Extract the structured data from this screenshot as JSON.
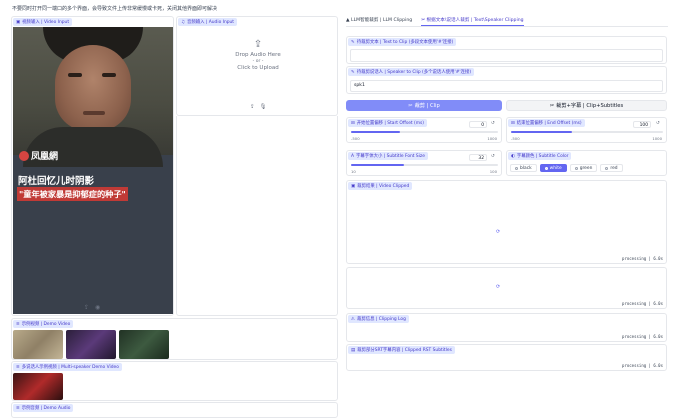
{
  "notice": "不要同时打开同一端口的多个界面，会导致文件上传非常缓慢或卡死，关闭其他界面即可解决",
  "video_input": {
    "label": "视频输入 | Video Input",
    "logo_text": "凤凰網",
    "caption_line1": "阿杜回忆儿时阴影",
    "caption_line2": "\"童年被家暴是抑郁症的种子\""
  },
  "audio_input": {
    "label": "音频输入 | Audio Input",
    "drop_text": "Drop Audio Here",
    "or_text": "- or -",
    "click_text": "Click to Upload"
  },
  "demo_video": {
    "label": "示例视频 | Demo Video"
  },
  "multi_speaker": {
    "label": "多说话人示例视频 | Multi-speaker Demo Video"
  },
  "demo_audio": {
    "label": "示例音频 | Demo Audio"
  },
  "tabs": [
    {
      "label": "LLM智能裁剪 | LLM Clipping"
    },
    {
      "label": "根据文本\\说话人裁剪 | Text\\Speaker Clipping"
    }
  ],
  "text_to_clip": {
    "label": "待裁剪文本 | Text to Clip (多段文本使用'#'连接)",
    "value": ""
  },
  "speaker_to_clip": {
    "label": "待裁剪说话人 | Speaker to Clip (多个说话人使用'#'连接)",
    "value": "spk1"
  },
  "clip_button": "裁剪 | Clip",
  "clip_subtitle_button": "裁剪+字幕 | Clip+Subtitles",
  "start_offset": {
    "label": "开始位置偏移 | Start Offset (ms)",
    "value": "0",
    "min": "-500",
    "max": "1000",
    "fraction": 0.33
  },
  "end_offset": {
    "label": "结束位置偏移 | End Offset (ms)",
    "value": "100",
    "min": "-500",
    "max": "1000",
    "fraction": 0.4
  },
  "font_size": {
    "label": "字幕字体大小 | Subtitle Font Size",
    "value": "32",
    "min": "10",
    "max": "100",
    "fraction": 0.36
  },
  "font_color": {
    "label": "字幕颜色 | Subtitle Color",
    "options": [
      "black",
      "white",
      "green",
      "red"
    ],
    "selected": "white"
  },
  "video_clipped": {
    "label": "裁剪结果 | Video Clipped",
    "status": "processing | 6.0s"
  },
  "audio_status": "processing | 6.0s",
  "clipping_log": {
    "label": "裁剪信息 | Clipping Log",
    "status": "processing | 6.0s"
  },
  "srt_subtitles": {
    "label": "裁剪部分SRT字幕内容 | Clipped RST Subtitles",
    "status": "processing | 6.0s"
  },
  "colors": {
    "accent": "#6366f1",
    "chip_bg": "#e0e7ff",
    "video_bg": "#39404b",
    "caption_red": "#c03a36"
  }
}
